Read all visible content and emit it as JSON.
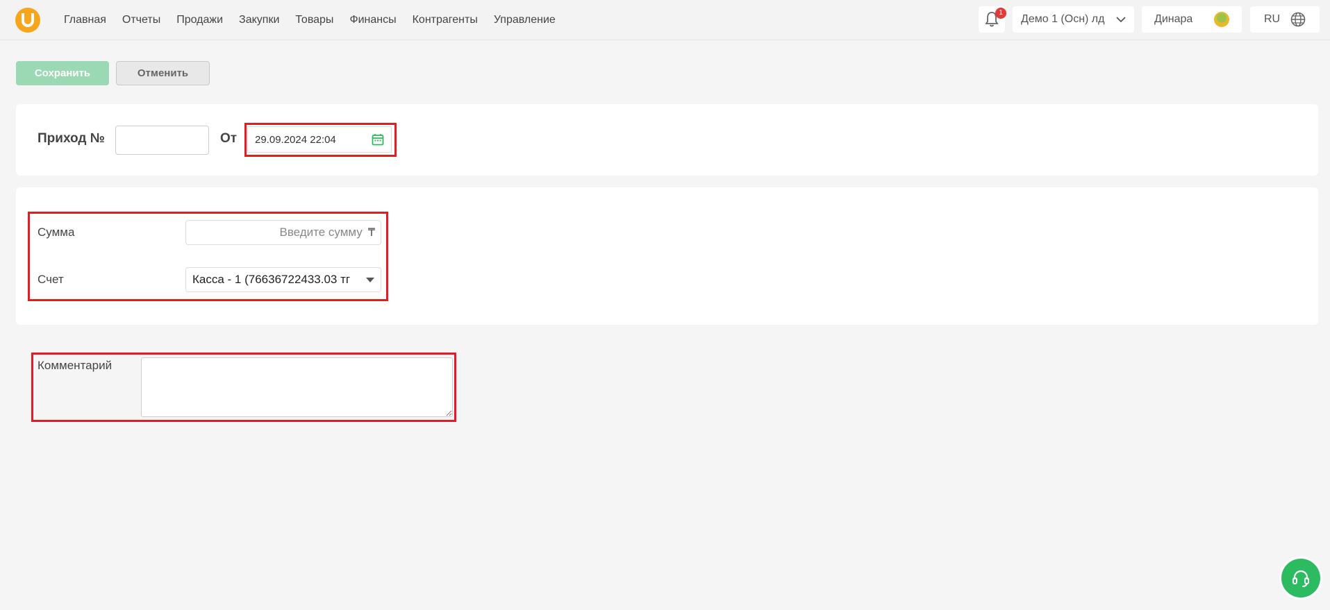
{
  "nav": {
    "items": [
      "Главная",
      "Отчеты",
      "Продажи",
      "Закупки",
      "Товары",
      "Финансы",
      "Контрагенты",
      "Управление"
    ]
  },
  "header": {
    "notification_count": "1",
    "organization": "Демо 1 (Осн) лд",
    "user_name": "Динара",
    "language": "RU"
  },
  "toolbar": {
    "save_label": "Сохранить",
    "cancel_label": "Отменить"
  },
  "document": {
    "title_label": "Приход №",
    "number_value": "",
    "from_label": "От",
    "date_value": "29.09.2024 22:04"
  },
  "payment": {
    "sum_label": "Сумма",
    "sum_placeholder": "Введите сумму",
    "currency_symbol": "₸",
    "account_label": "Счет",
    "account_value": "Касса - 1 (76636722433.03 тг"
  },
  "comment": {
    "label": "Комментарий",
    "value": ""
  },
  "colors": {
    "accent_green": "#2dbb62",
    "save_button": "#9bd9b4",
    "highlight_red": "#e31b23",
    "logo_orange": "#f7a51c"
  }
}
